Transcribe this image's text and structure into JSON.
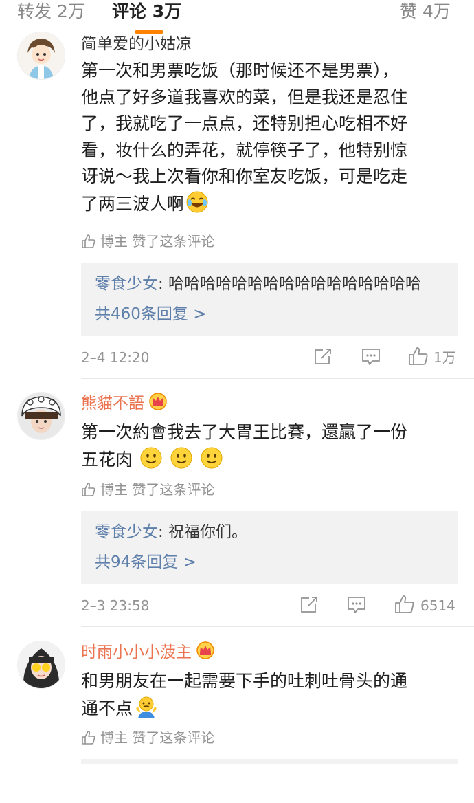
{
  "tabs": {
    "repost": "转发 2万",
    "comments": "评论 3万",
    "likes": "赞 4万"
  },
  "comments": [
    {
      "username": "简单爱的小姑凉",
      "lines": [
        "第一次和男票吃饭（那时候还不是男票），",
        "他点了好多道我喜欢的菜，但是我还是忍住",
        "了，我就吃了一点点，还特别担心吃相不好",
        "看，妆什么的弄花，就停筷子了，他特别惊",
        "讶说～我上次看你和你室友吃饭，可是吃走",
        "了两三波人啊"
      ],
      "emoji": "laugh-cry-emoji",
      "liked_by_author": "博主 赞了这条评论",
      "reply_user": "零食少女",
      "reply_text": ": 哈哈哈哈哈哈哈哈哈哈哈哈哈哈哈哈",
      "reply_more": "共460条回复 >",
      "time": "2–4 12:20",
      "like_count": "1万"
    },
    {
      "username": "熊貓不語",
      "lines": [
        "第一次約會我去了大胃王比賽，還贏了一份",
        "五花肉"
      ],
      "emoji": "smile-emoji",
      "liked_by_author": "博主 赞了这条评论",
      "reply_user": "零食少女",
      "reply_text": ": 祝福你们。",
      "reply_more": "共94条回复 >",
      "time": "2–3 23:58",
      "like_count": "6514"
    },
    {
      "username": "时雨小小小菠主",
      "lines": [
        "和男朋友在一起需要下手的吐刺吐骨头的通",
        "通不点"
      ],
      "emoji": "shrug-emoji",
      "liked_by_author": "博主 赞了这条评论"
    }
  ],
  "colors": {
    "accent": "#ff8200",
    "username_vip": "#eb7350",
    "reply_link": "#5d7faa",
    "meta_gray": "#939393",
    "reply_bg": "#f2f2f2"
  }
}
